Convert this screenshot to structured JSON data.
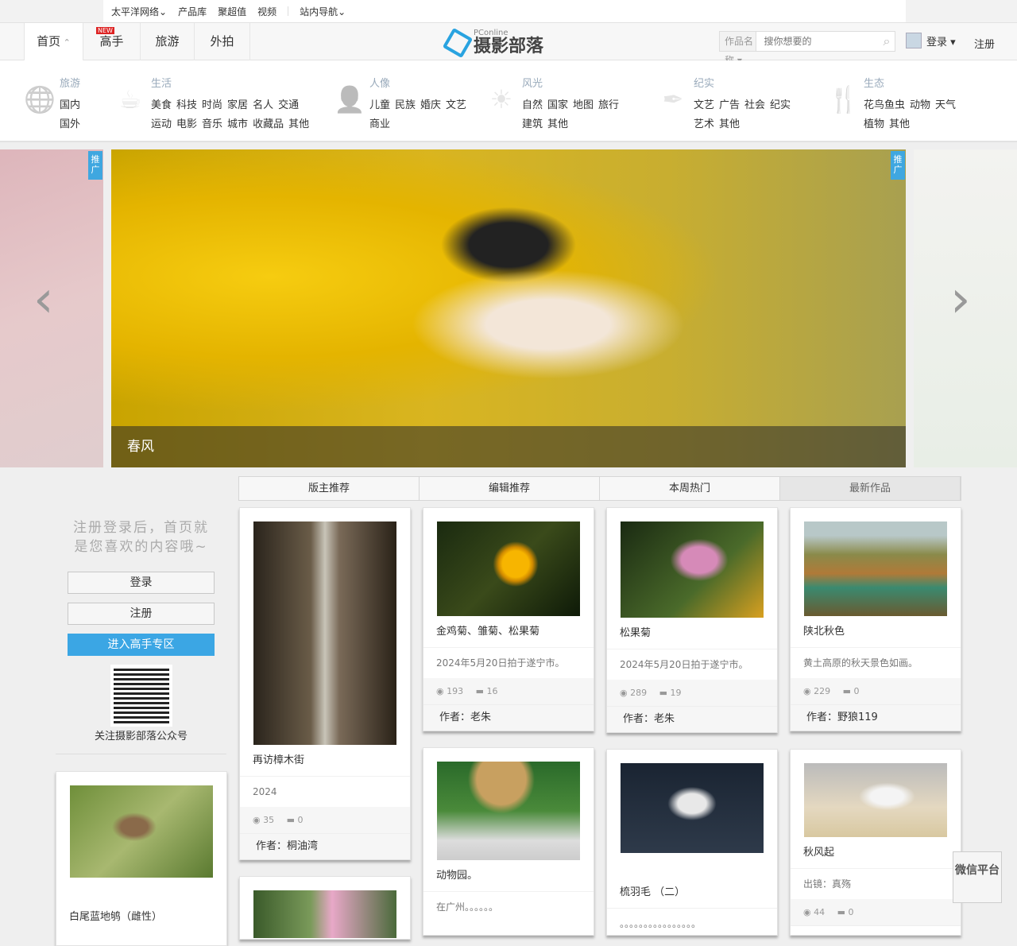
{
  "topbar": {
    "items": [
      "太平洋网络⌄",
      "产品库",
      "聚超值",
      "视频"
    ],
    "nav": "站内导航⌄"
  },
  "nav": {
    "tabs": [
      "首页",
      "高手",
      "旅游",
      "外拍"
    ],
    "new_badge": "NEW"
  },
  "logo": {
    "small": "PConline",
    "big": "摄影部落"
  },
  "search": {
    "select": "作品名称 ▾",
    "placeholder": "搜你想要的"
  },
  "user": {
    "login": "登录 ▾",
    "register": "注册"
  },
  "categories": [
    {
      "title": "旅游",
      "icon": "globe-icon",
      "rows": [
        [
          "国内"
        ],
        [
          "国外"
        ]
      ]
    },
    {
      "title": "生活",
      "icon": "cup-icon",
      "rows": [
        [
          "美食",
          "科技",
          "时尚",
          "家居",
          "名人",
          "交通"
        ],
        [
          "运动",
          "电影",
          "音乐",
          "城市",
          "收藏品",
          "其他"
        ]
      ]
    },
    {
      "title": "人像",
      "icon": "person-icon",
      "rows": [
        [
          "儿童",
          "民族",
          "婚庆",
          "文艺"
        ],
        [
          "商业"
        ]
      ]
    },
    {
      "title": "风光",
      "icon": "sun-icon",
      "rows": [
        [
          "自然",
          "国家",
          "地图",
          "旅行"
        ],
        [
          "建筑",
          "其他"
        ]
      ]
    },
    {
      "title": "纪实",
      "icon": "pen-icon",
      "rows": [
        [
          "文艺",
          "广告",
          "社会",
          "纪实"
        ],
        [
          "艺术",
          "其他"
        ]
      ]
    },
    {
      "title": "生态",
      "icon": "fork-icon",
      "rows": [
        [
          "花鸟鱼虫",
          "动物",
          "天气"
        ],
        [
          "植物",
          "其他"
        ]
      ]
    }
  ],
  "hero": {
    "caption": "春风",
    "tag": "推广"
  },
  "tabs": [
    "版主推荐",
    "编辑推荐",
    "本周热门",
    "最新作品"
  ],
  "sidebar": {
    "hint": "注册登录后，首页就是您喜欢的内容哦~",
    "login": "登录",
    "register": "注册",
    "pro": "进入高手专区",
    "qr_caption": "关注摄影部落公众号",
    "card_title": "白尾蓝地鸲（雌性）"
  },
  "cards": [
    {
      "title": "再访樟木街",
      "desc": "2024",
      "views": "35",
      "comments": "0",
      "author": "作者：桐油湾"
    },
    {
      "title": "金鸡菊、雏菊、松果菊",
      "desc": "2024年5月20日拍于遂宁市。",
      "views": "193",
      "comments": "16",
      "author": "作者：老朱"
    },
    {
      "title": "松果菊",
      "desc": "2024年5月20日拍于遂宁市。",
      "views": "289",
      "comments": "19",
      "author": "作者：老朱"
    },
    {
      "title": "陕北秋色",
      "desc": "黄土高原的秋天景色如画。",
      "views": "229",
      "comments": "0",
      "author": "作者：野狼119"
    },
    {
      "title": "动物园。",
      "desc": "在广州。。。。。。"
    },
    {
      "title": "梳羽毛 （二）",
      "desc": "。。。。。。。。。。。。。。。。"
    },
    {
      "title": "秋风起",
      "desc": "出镜：真殇",
      "views": "44",
      "comments": "0"
    }
  ],
  "weixin": "微信平台"
}
